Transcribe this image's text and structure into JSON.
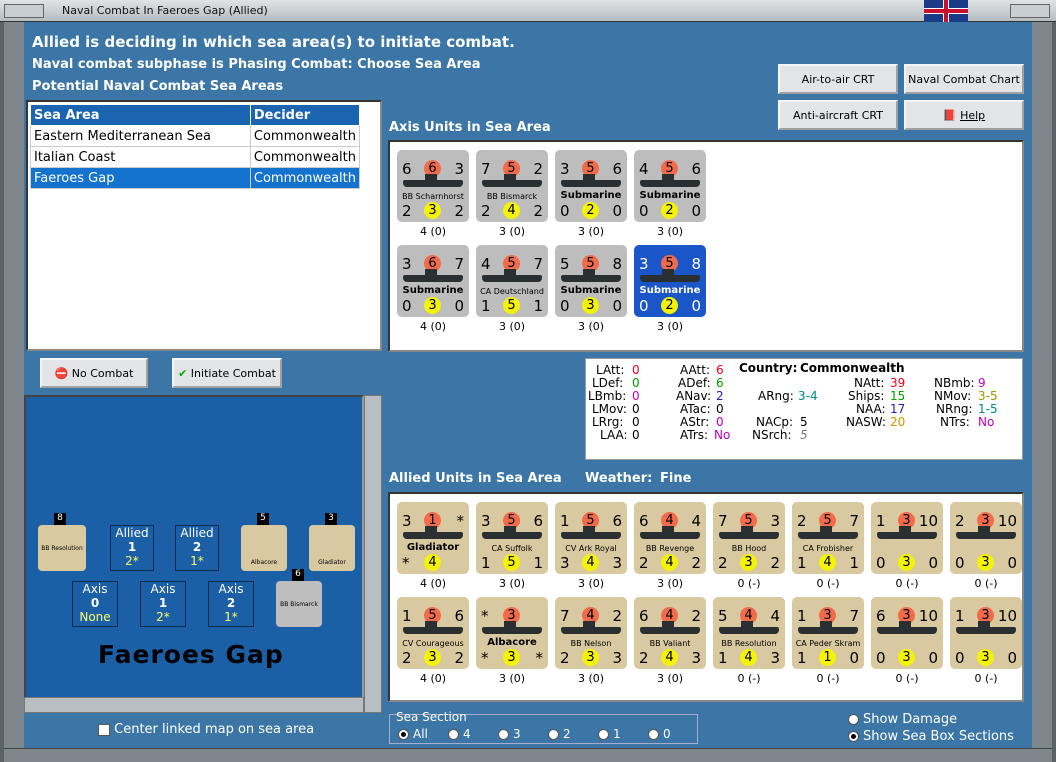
{
  "window": {
    "title": "Naval Combat In Faeroes Gap (Allied)"
  },
  "headers": {
    "line1": "Allied is deciding in which sea area(s) to initiate combat.",
    "line2": "Naval combat subphase is Phasing Combat: Choose Sea Area",
    "line3": "Potential Naval Combat Sea Areas"
  },
  "buttons": {
    "air_to_air": "Air-to-air CRT",
    "naval_chart": "Naval Combat Chart",
    "anti_aircraft": "Anti-aircraft CRT",
    "help": "Help",
    "no_combat": "No Combat",
    "initiate_combat": "Initiate Combat"
  },
  "sea_table": {
    "col_area": "Sea Area",
    "col_decider": "Decider",
    "rows": [
      {
        "area": "Eastern Mediterranean Sea",
        "decider": "Commonwealth"
      },
      {
        "area": "Italian Coast",
        "decider": "Commonwealth"
      },
      {
        "area": "Faeroes Gap",
        "decider": "Commonwealth"
      }
    ]
  },
  "axis_section": "Axis Units in Sea Area",
  "allied_section": "Allied Units in Sea Area",
  "weather_label": "Weather:",
  "weather_value": "Fine",
  "axis_units": [
    {
      "tl": "6",
      "tc": "6",
      "tr": "3",
      "name": "BB Scharnhorst",
      "bl": "2",
      "bc": "3",
      "br": "2",
      "cap": "4 (0)"
    },
    {
      "tl": "7",
      "tc": "5",
      "tr": "2",
      "name": "BB Bismarck",
      "bl": "2",
      "bc": "4",
      "br": "2",
      "cap": "3 (0)"
    },
    {
      "tl": "3",
      "tc": "5",
      "tr": "6",
      "name": "Submarine",
      "bl": "0",
      "bc": "2",
      "br": "0",
      "cap": "3 (0)"
    },
    {
      "tl": "4",
      "tc": "5",
      "tr": "6",
      "name": "Submarine",
      "bl": "0",
      "bc": "2",
      "br": "0",
      "cap": "3 (0)"
    },
    {
      "tl": "3",
      "tc": "6",
      "tr": "7",
      "name": "Submarine",
      "bl": "0",
      "bc": "3",
      "br": "0",
      "cap": "4 (0)"
    },
    {
      "tl": "4",
      "tc": "5",
      "tr": "7",
      "name": "CA Deutschland",
      "bl": "1",
      "bc": "5",
      "br": "1",
      "cap": "3 (0)"
    },
    {
      "tl": "5",
      "tc": "5",
      "tr": "8",
      "name": "Submarine",
      "bl": "0",
      "bc": "3",
      "br": "0",
      "cap": "3 (0)"
    },
    {
      "tl": "3",
      "tc": "5",
      "tr": "8",
      "name": "Submarine",
      "bl": "0",
      "bc": "2",
      "br": "0",
      "cap": "3 (0)"
    }
  ],
  "allied_units_row1": [
    {
      "tl": "3",
      "tc": "1",
      "tr": "*",
      "name": "Gladiator",
      "bl": "*",
      "bc": "4",
      "br": "",
      "cap": "4 (0)"
    },
    {
      "tl": "3",
      "tc": "5",
      "tr": "6",
      "name": "CA Suffolk",
      "bl": "1",
      "bc": "5",
      "br": "1",
      "cap": "3 (0)"
    },
    {
      "tl": "1",
      "tc": "5",
      "tr": "6",
      "name": "CV Ark Royal",
      "bl": "3",
      "bc": "4",
      "br": "3",
      "cap": "3 (0)"
    },
    {
      "tl": "6",
      "tc": "4",
      "tr": "4",
      "name": "BB Revenge",
      "bl": "2",
      "bc": "4",
      "br": "2",
      "cap": "3 (0)"
    },
    {
      "tl": "7",
      "tc": "5",
      "tr": "3",
      "name": "BB Hood",
      "bl": "2",
      "bc": "3",
      "br": "2",
      "cap": "0 (-)"
    },
    {
      "tl": "2",
      "tc": "5",
      "tr": "7",
      "name": "CA Frobisher",
      "bl": "1",
      "bc": "4",
      "br": "1",
      "cap": "0 (-)"
    },
    {
      "tl": "1",
      "tc": "3",
      "tr": "10",
      "name": "",
      "bl": "0",
      "bc": "3",
      "br": "0",
      "cap": "0 (-)"
    },
    {
      "tl": "2",
      "tc": "3",
      "tr": "10",
      "name": "",
      "bl": "0",
      "bc": "3",
      "br": "0",
      "cap": "0 (-)"
    }
  ],
  "allied_units_row2": [
    {
      "tl": "1",
      "tc": "5",
      "tr": "6",
      "name": "CV Courageous",
      "bl": "2",
      "bc": "3",
      "br": "2",
      "cap": "4 (0)"
    },
    {
      "tl": "*",
      "tc": "3",
      "tr": "",
      "name": "Albacore",
      "bl": "*",
      "bc": "3",
      "br": "*",
      "cap": "3 (0)"
    },
    {
      "tl": "7",
      "tc": "4",
      "tr": "2",
      "name": "BB Nelson",
      "bl": "2",
      "bc": "3",
      "br": "3",
      "cap": "3 (0)"
    },
    {
      "tl": "6",
      "tc": "4",
      "tr": "2",
      "name": "BB Valiant",
      "bl": "2",
      "bc": "4",
      "br": "3",
      "cap": "3 (0)"
    },
    {
      "tl": "5",
      "tc": "4",
      "tr": "4",
      "name": "BB Resolution",
      "bl": "1",
      "bc": "4",
      "br": "3",
      "cap": "0 (-)"
    },
    {
      "tl": "1",
      "tc": "3",
      "tr": "7",
      "name": "CA Peder Skram",
      "bl": "1",
      "bc": "1",
      "br": "0",
      "cap": "0 (-)"
    },
    {
      "tl": "6",
      "tc": "3",
      "tr": "10",
      "name": "",
      "bl": "0",
      "bc": "3",
      "br": "0",
      "cap": "0 (-)"
    },
    {
      "tl": "1",
      "tc": "3",
      "tr": "10",
      "name": "",
      "bl": "0",
      "bc": "3",
      "br": "0",
      "cap": "0 (-)"
    }
  ],
  "stats": {
    "latt": "LAtt:",
    "latt_v": "0",
    "ldef": "LDef:",
    "ldef_v": "0",
    "lbmb": "LBmb:",
    "lbmb_v": "0",
    "lmov": "LMov:",
    "lmov_v": "0",
    "lrrg": "LRrg:",
    "lrrg_v": "0",
    "laa": "LAA:",
    "laa_v": "0",
    "aatt": "AAtt:",
    "aatt_v": "6",
    "adef": "ADef:",
    "adef_v": "6",
    "anav": "ANav:",
    "anav_v": "2",
    "atac": "ATac:",
    "atac_v": "0",
    "astr": "AStr:",
    "astr_v": "0",
    "atrs": "ATrs:",
    "atrs_v": "No",
    "country": "Country:",
    "country_v": "Commonwealth",
    "arng": "ARng:",
    "arng_v": "3-4",
    "nacp": "NACp:",
    "nacp_v": "5",
    "nsrch": "NSrch:",
    "nsrch_v": "5",
    "natt": "NAtt:",
    "natt_v": "39",
    "ships": "Ships:",
    "ships_v": "15",
    "naa": "NAA:",
    "naa_v": "17",
    "nasw": "NASW:",
    "nasw_v": "20",
    "nbmb": "NBmb:",
    "nbmb_v": "9",
    "nmov": "NMov:",
    "nmov_v": "3-5",
    "nrng": "NRng:",
    "nrng_v": "1-5",
    "ntrs": "NTrs:",
    "ntrs_v": "No"
  },
  "map": {
    "title": "Faeroes Gap",
    "allied1_label": "Allied",
    "allied1_n": "1",
    "allied1_s": "2*",
    "allied2_label": "Allied",
    "allied2_n": "2",
    "allied2_s": "1*",
    "axis0_label": "Axis",
    "axis0_n": "0",
    "axis0_s": "None",
    "axis1_label": "Axis",
    "axis1_n": "1",
    "axis1_s": "2*",
    "axis2_label": "Axis",
    "axis2_n": "2",
    "axis2_s": "1*",
    "stack1": "8",
    "stack2": "5",
    "stack3": "3",
    "stack4": "6",
    "bbres": "BB Resolution",
    "albacore": "Albacore",
    "gladiator": "Gladiator",
    "bbbis": "BB Bismarck"
  },
  "center_map_label": "Center linked map on sea area",
  "sea_section": {
    "title": "Sea Section",
    "opts": [
      "All",
      "4",
      "3",
      "2",
      "1",
      "0"
    ]
  },
  "show_damage": "Show Damage",
  "show_sea_box": "Show Sea Box Sections"
}
